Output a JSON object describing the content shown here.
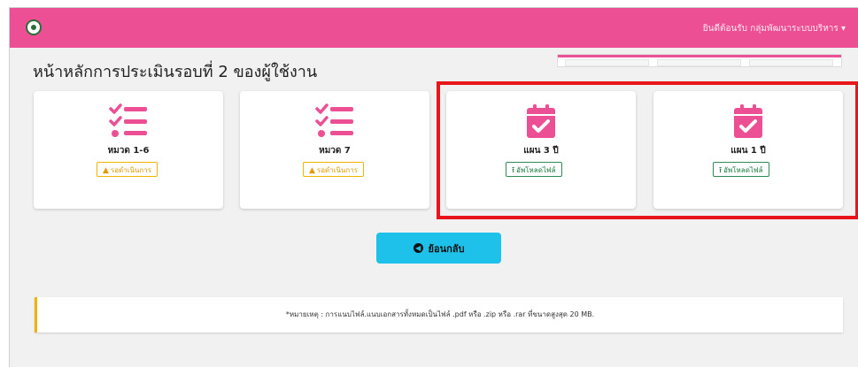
{
  "navbar": {
    "user_menu": "ยินดีต้อนรับ กลุ่มพัฒนาระบบบริหาร ▾",
    "bg_color": "#ec4f94"
  },
  "page": {
    "title": "หน้าหลักการประเมินรอบที่ 2 ของผู้ใช้งาน"
  },
  "cards": [
    {
      "label": "หมวด 1-6",
      "icon": "checklist-icon",
      "status": "รอดำเนินการ",
      "status_type": "pending"
    },
    {
      "label": "หมวด 7",
      "icon": "checklist-icon",
      "status": "รอดำเนินการ",
      "status_type": "pending"
    },
    {
      "label": "แผน 3 ปี",
      "icon": "calendar-check-icon",
      "status": "อัพโหลดไฟล์",
      "status_type": "upload"
    },
    {
      "label": "แผน 1 ปี",
      "icon": "calendar-check-icon",
      "status": "อัพโหลดไฟล์",
      "status_type": "upload"
    }
  ],
  "back_button": {
    "label": "ย้อนกลับ"
  },
  "note": {
    "text": "*หมายเหตุ : การแนบไฟล์.แนบเอกสารทั้งหมดเป็นไฟล์ .pdf หรือ .zip หรือ .rar ที่ขนาดสูงสุด 20 MB."
  },
  "colors": {
    "accent": "#ec4f94",
    "pending": "#f0b400",
    "upload": "#2e8b57",
    "button": "#1ec1ea",
    "highlight": "#e8161b"
  }
}
